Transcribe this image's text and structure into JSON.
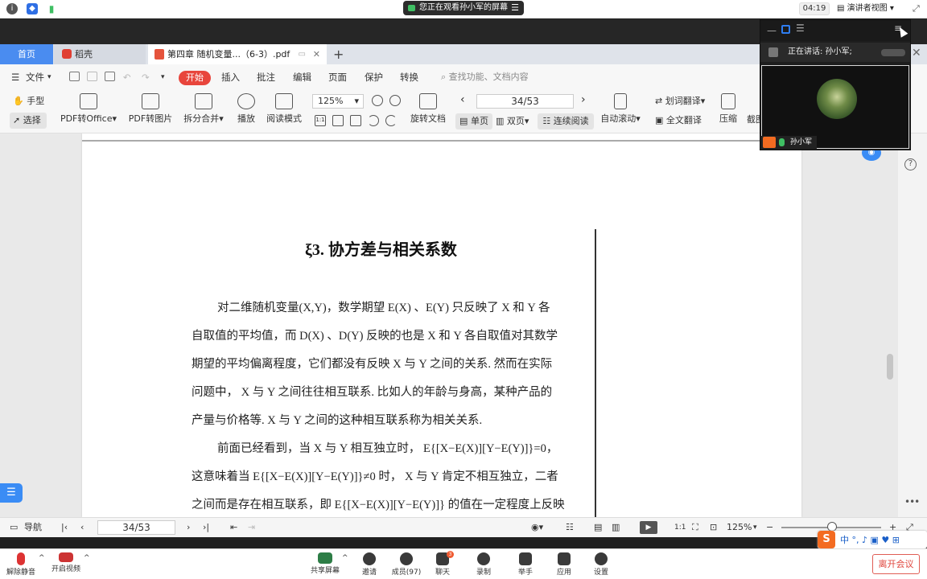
{
  "meeting_top": {
    "sharing_text": "您正在观看孙小军的屏幕",
    "clock": "04:19",
    "presenter_view": "演讲者视图"
  },
  "tabs": {
    "home": "首页",
    "daoke": "稻壳",
    "document": "第四章 随机变量...（6-3）.pdf",
    "add": "+"
  },
  "menu": {
    "file": "文件",
    "start": "开始",
    "insert": "插入",
    "comment": "批注",
    "edit": "编辑",
    "page": "页面",
    "protect": "保护",
    "convert": "转换",
    "search_placeholder": "查找功能、文档内容"
  },
  "ribbon": {
    "hand": "手型",
    "select": "选择",
    "pdf_to_office": "PDF转Office",
    "pdf_to_image": "PDF转图片",
    "split_merge": "拆分合并",
    "play": "播放",
    "read_mode": "阅读模式",
    "zoom": "125%",
    "rotate": "旋转文档",
    "page_value": "34/53",
    "single": "单页",
    "double": "双页",
    "continuous": "连续阅读",
    "auto_scroll": "自动滚动",
    "word_translate": "划词翻译",
    "full_translate": "全文翻译",
    "compress": "压缩",
    "screenshot": "截图"
  },
  "document": {
    "title": "ξ3. 协方差与相关系数",
    "lines": [
      "对二维随机变量(X,Y)，数学期望 E(X) 、E(Y) 只反映了 X 和 Y 各",
      "自取值的平均值，而 D(X) 、D(Y) 反映的也是 X 和 Y 各自取值对其数学",
      "期望的平均偏离程度，它们都没有反映 X 与 Y 之间的关系. 然而在实际",
      "问题中， X 与 Y 之间往往相互联系. 比如人的年龄与身高，某种产品的",
      "产量与价格等.  X 与 Y 之间的这种相互联系称为相关关系.",
      "前面已经看到，当 X 与 Y 相互独立时， E{[X−E(X)][Y−E(Y)]}=0，",
      "这意味着当 E{[X−E(X)][Y−E(Y)]}≠0 时， X 与 Y 肯定不相互独立，二者",
      "之间而是存在相互联系，即 E{[X−E(X)][Y−E(Y)]} 的值在一定程度上反映"
    ]
  },
  "statusbar": {
    "nav": "导航",
    "page_value": "34/53",
    "zoom": "125%"
  },
  "video": {
    "speaking": "正在讲话: 孙小军;",
    "name": "孙小军"
  },
  "meeting_bottom": {
    "unmute": "解除静音",
    "video": "开启视频",
    "share": "共享屏幕",
    "invite": "邀请",
    "members": "成员(97)",
    "chat": "聊天",
    "chat_badge": "3",
    "record": "录制",
    "raise_hand": "举手",
    "apps": "应用",
    "settings": "设置",
    "leave": "离开会议"
  },
  "ime": {
    "brand": "S",
    "items": "中 °, ♪ ▣ ♥ ⊞"
  },
  "colors": {
    "accent": "#4a8cf0",
    "start_red": "#e8453c",
    "leave_red": "#e0453c"
  }
}
